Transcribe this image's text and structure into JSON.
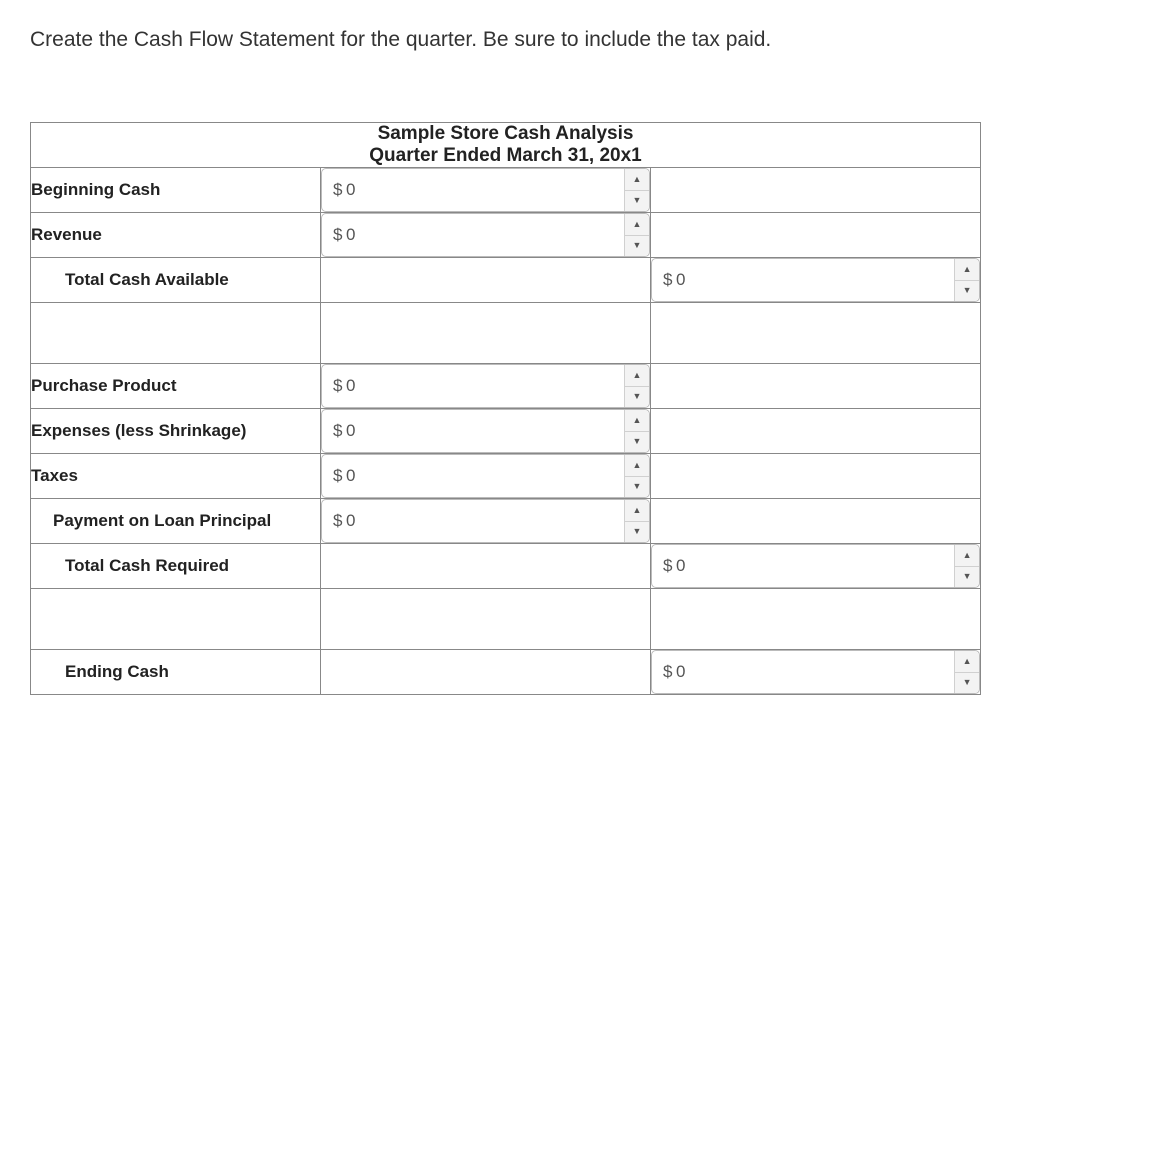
{
  "instruction": "Create the Cash Flow Statement for the quarter. Be sure to include the tax paid.",
  "table": {
    "title": "Sample Store Cash Analysis",
    "subtitle": "Quarter Ended March 31, 20x1"
  },
  "currency_symbol": "$",
  "rows": {
    "beginning_cash": {
      "label": "Beginning Cash",
      "value": "0"
    },
    "revenue": {
      "label": "Revenue",
      "value": "0"
    },
    "total_cash_available": {
      "label": "Total Cash Available",
      "value": "0"
    },
    "purchase_product": {
      "label": "Purchase Product",
      "value": "0"
    },
    "expenses_less_shrinkage": {
      "label": "Expenses (less Shrinkage)",
      "value": "0"
    },
    "taxes": {
      "label": "Taxes",
      "value": "0"
    },
    "payment_on_loan_principal": {
      "label": "Payment on Loan Principal",
      "value": "0"
    },
    "total_cash_required": {
      "label": "Total Cash Required",
      "value": "0"
    },
    "ending_cash": {
      "label": "Ending Cash",
      "value": "0"
    }
  }
}
